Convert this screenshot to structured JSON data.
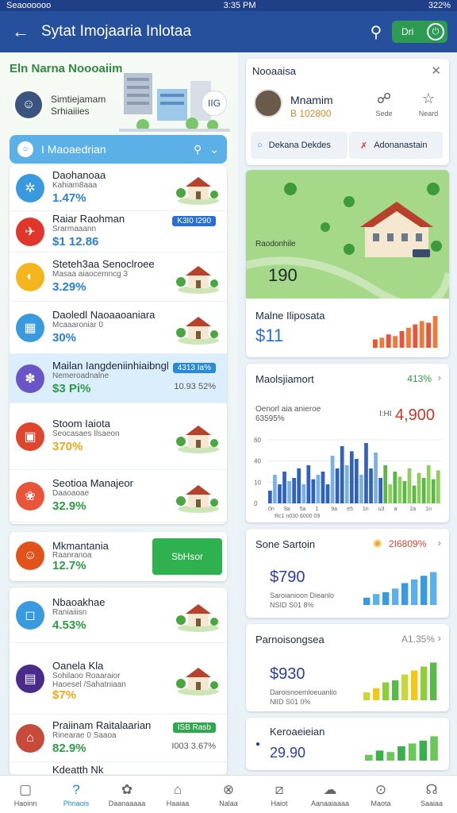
{
  "status": {
    "carrier": "Seaoooooo",
    "time": "3:35 PM",
    "battery": "322%"
  },
  "header": {
    "title": "Sytat Imojaaria Inlotaa",
    "toggle_label": "Dri"
  },
  "left": {
    "area_title": "Eln Narna Noooaiim",
    "profile_name": "Simtiejamam\nSrhiaiiies",
    "map_badge": "IIG",
    "dropdown_label": "I Maoaedrian",
    "rows1": [
      {
        "name": "Daohanoaa",
        "sub": "Kahiam8aaa",
        "value": "1.47%",
        "color": "#3a9ae0",
        "valcolor": "#2b7fd4",
        "icon": "✲"
      },
      {
        "name": "Raiar Raohman",
        "sub": "Srarmaaann",
        "value": "$1 12.86",
        "color": "#e0362c",
        "valcolor": "#2b7fd4",
        "chip": "K3I0 I290",
        "chipcolor": "#2b6fd4",
        "icon": "✈"
      },
      {
        "name": "Steteh3aa Senoclroee",
        "sub": "Masaa aiaocemncg 3",
        "value": "3.29%",
        "color": "#f4b51d",
        "valcolor": "#2b7fd4",
        "icon": "◐"
      },
      {
        "name": "Daoledl Naoaaoaniara",
        "sub": "Mcaaaroniar 0",
        "value": "30%",
        "color": "#3a9ae0",
        "valcolor": "#2b7fd4",
        "icon": "▦"
      },
      {
        "name": "Mailan Iangdeniinhiaibngl",
        "sub": "Nemeroadnalne",
        "value": "$3 Pi%",
        "color": "#6a55c8",
        "valcolor": "#2e9c45",
        "chip": "4313 Ia%",
        "chipcolor": "#2b8ad6",
        "chipval": "10.93 52%",
        "icon": "✽"
      },
      {
        "name": "Stoom Iaiota",
        "sub": "Seocasaes Ilsaeon",
        "value": "370%",
        "color": "#e0452e",
        "valcolor": "#f0a81a",
        "icon": "▣"
      },
      {
        "name": "Seotioa Manajeor",
        "sub": "Daaoaoae",
        "value": "32.9%",
        "color": "#e8553a",
        "valcolor": "#2e9c45",
        "icon": "❀"
      }
    ],
    "promo": {
      "name": "Mkmantania",
      "sub": "Raanranoa",
      "value": "12.7%",
      "button": "SbHsor"
    },
    "rows2": [
      {
        "name": "Nbaoakhae",
        "sub": "Raniaiiisn",
        "value": "4.53%",
        "color": "#3a9ae0",
        "valcolor": "#2e9c45",
        "icon": "◻"
      },
      {
        "name": "Oanela Kla",
        "sub": "Sohilaoo Roaaraior\nHaoesel /Sahatniaan",
        "value": "$7%",
        "color": "#4a2a8a",
        "valcolor": "#f0a81a",
        "icon": "▤"
      },
      {
        "name": "Praiinam Raitalaarian",
        "sub": "Rinearae 0 Saaoa",
        "value": "82.9%",
        "color": "#c84a3a",
        "valcolor": "#2e9c45",
        "chip": "ISB Rasb",
        "chipcolor": "#2fa84f",
        "chipval": "I003 3.67%",
        "icon": "⌂"
      }
    ],
    "last_name": "Kdeatth Nk"
  },
  "right": {
    "card1": {
      "title": "Nooaaisa",
      "user": "Mnamim",
      "sub": "B 102800",
      "act1": "Sede",
      "act2": "Neard",
      "btn1": "Dekana Dekdes",
      "btn2": "Adonanastain"
    },
    "map": {
      "label": "Raodonhile",
      "value": "190"
    },
    "card2": {
      "title": "Malne Iliposata",
      "value": "$11"
    },
    "card3": {
      "title": "Maolsjiamort",
      "change": "413%",
      "sub1": "Oenorl aia anieroe",
      "sub2": "63595%",
      "mark": "I:HI",
      "value": "4,900"
    },
    "card4": {
      "title": "Sone Sartoin",
      "change": "2I6809%",
      "value": "$790",
      "sub": "Saroianioon Dieanlo\nNSID S01 8%"
    },
    "card5": {
      "title": "Parnoisongsea",
      "change": "A1.35%",
      "value": "$930",
      "sub": "Daroisnoemloeuanlio\nNlID S01 0%"
    },
    "card6": {
      "title": "Keroaeieian",
      "value": "29.90"
    }
  },
  "chart_data": {
    "type": "bar",
    "categories": [
      "1",
      "2",
      "3",
      "4",
      "5",
      "6",
      "7",
      "8",
      "9",
      "10",
      "11",
      "12",
      "13",
      "14",
      "15",
      "16",
      "17",
      "18",
      "19",
      "20",
      "21",
      "22",
      "23",
      "24",
      "25",
      "26",
      "27",
      "28",
      "29",
      "30",
      "31",
      "32",
      "33",
      "34",
      "35",
      "36"
    ],
    "series": [
      {
        "values": [
          20,
          45,
          30,
          50,
          35,
          40,
          55,
          30,
          60,
          38,
          45,
          50,
          30,
          75,
          55,
          90,
          60,
          82,
          70,
          45,
          95,
          55,
          80,
          40,
          60,
          30,
          50,
          42,
          35,
          55,
          28,
          48,
          40,
          60,
          38,
          52
        ]
      }
    ],
    "yticks": [
      "60",
      "40",
      "10",
      "0"
    ],
    "xlabels": [
      "0n",
      "9a",
      "5a",
      "1",
      "9a",
      "e5",
      "1n",
      "u3",
      "a",
      "2a",
      "1n"
    ],
    "xcaption": "Rc1 n030 6000 09",
    "ylim": [
      0,
      100
    ]
  },
  "nav": [
    {
      "label": "Haoinn",
      "icon": "▢"
    },
    {
      "label": "Phnaois",
      "icon": "?"
    },
    {
      "label": "Daanaaaaa",
      "icon": "✿"
    },
    {
      "label": "Haaiaa",
      "icon": "⌂"
    },
    {
      "label": "Nalaa",
      "icon": "⊗"
    },
    {
      "label": "Haiot",
      "icon": "⧄"
    },
    {
      "label": "Aanaaiaaaa",
      "icon": "☁"
    },
    {
      "label": "Maota",
      "icon": "⊙"
    },
    {
      "label": "Saaiaa",
      "icon": "☊"
    }
  ]
}
